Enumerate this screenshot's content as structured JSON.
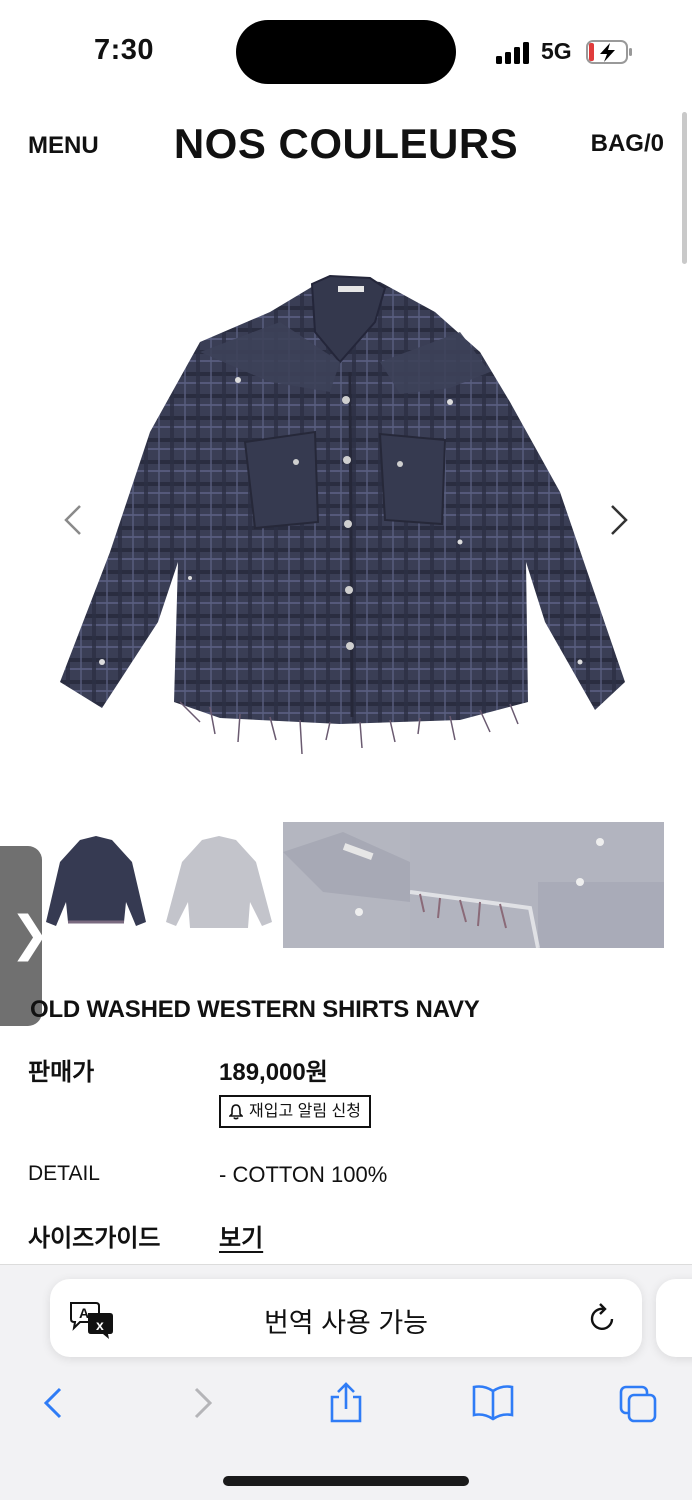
{
  "status_bar": {
    "time": "7:30",
    "network": "5G"
  },
  "header": {
    "menu_label": "MENU",
    "brand": "NOS COULEURS",
    "bag_label": "BAG/0"
  },
  "product": {
    "name": "OLD WASHED WESTERN SHIRTS NAVY",
    "price_label": "판매가",
    "price": "189,000원",
    "restock_button": "재입고 알림 신청",
    "detail_label": "DETAIL",
    "detail_value": "- COTTON 100%",
    "size_guide_label": "사이즈가이드",
    "size_guide_link": "보기"
  },
  "thumbnails": [
    "front-navy",
    "front-faded",
    "collar-detail",
    "hem-detail"
  ],
  "side_tab_symbol": "❯",
  "browser": {
    "address_text": "번역 사용 가능",
    "toolbar": [
      "back-icon",
      "forward-icon",
      "share-icon",
      "bookmarks-icon",
      "tabs-icon"
    ]
  },
  "colors": {
    "accent": "#2f7cf6",
    "shirt": "#3b3f55",
    "side_tab": "#707070"
  }
}
